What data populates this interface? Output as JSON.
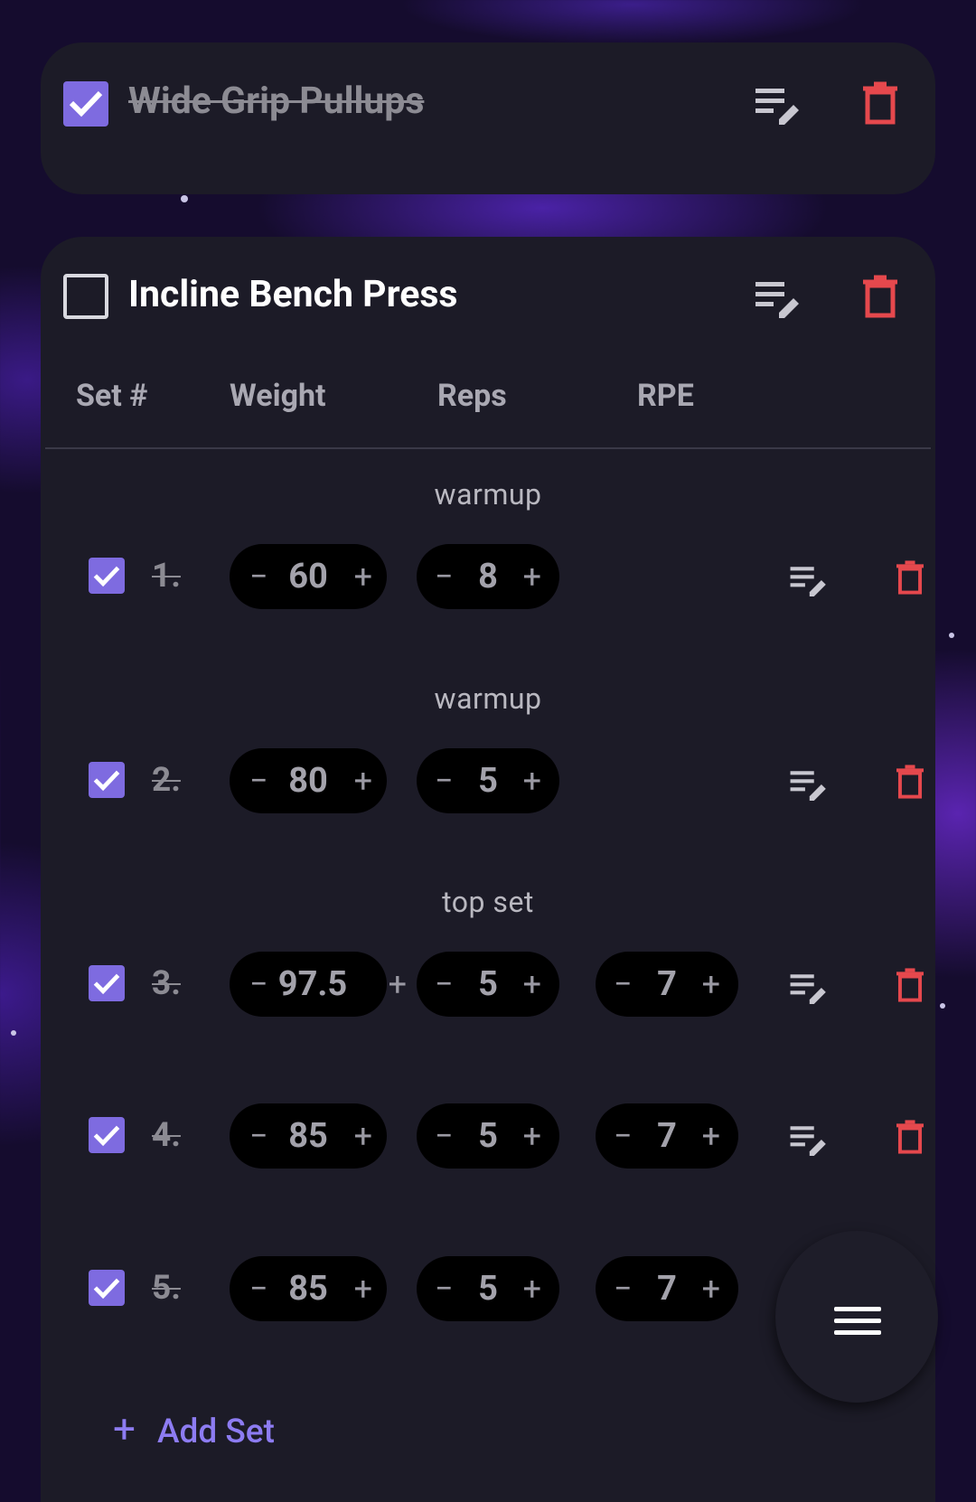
{
  "exercises": [
    {
      "name": "Wide Grip Pullups",
      "completed": true,
      "icons": {
        "edit": "edit-notes-icon",
        "delete": "trash-icon"
      }
    },
    {
      "name": "Incline Bench Press",
      "completed": false,
      "icons": {
        "edit": "edit-notes-icon",
        "delete": "trash-icon"
      },
      "columns": [
        "Set #",
        "Weight",
        "Reps",
        "RPE"
      ],
      "sets": [
        {
          "number": "1.",
          "note": "warmup",
          "weight": "60",
          "reps": "8",
          "rpe": null,
          "completed": true
        },
        {
          "number": "2.",
          "note": "warmup",
          "weight": "80",
          "reps": "5",
          "rpe": null,
          "completed": true
        },
        {
          "number": "3.",
          "note": "top set",
          "weight": "97.5",
          "reps": "5",
          "rpe": "7",
          "completed": true
        },
        {
          "number": "4.",
          "note": "",
          "weight": "85",
          "reps": "5",
          "rpe": "7",
          "completed": true
        },
        {
          "number": "5.",
          "note": "",
          "weight": "85",
          "reps": "5",
          "rpe": "7",
          "completed": true
        }
      ],
      "add_set_label": "Add Set"
    }
  ],
  "stepper_symbols": {
    "minus": "−",
    "plus": "+"
  },
  "fab_icon": "menu-icon",
  "colors": {
    "accent": "#7e6be0",
    "danger": "#e5484d",
    "card": "#1c1b27",
    "pill": "#000000"
  }
}
